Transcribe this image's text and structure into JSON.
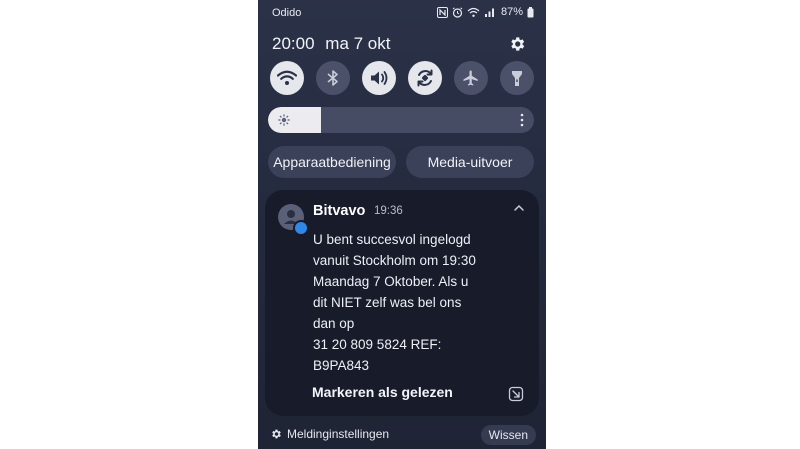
{
  "status_bar": {
    "carrier": "Odido",
    "battery": "87%",
    "icons": [
      "nfc-icon",
      "alarm-icon",
      "wifi-icon",
      "signal-icon",
      "battery-icon"
    ]
  },
  "header": {
    "time": "20:00",
    "date": "ma 7 okt"
  },
  "quick_settings": [
    {
      "icon": "wifi-icon",
      "state": "on"
    },
    {
      "icon": "bluetooth-icon",
      "state": "off"
    },
    {
      "icon": "sound-icon",
      "state": "on"
    },
    {
      "icon": "auto-rotate-icon",
      "state": "on"
    },
    {
      "icon": "airplane-mode-icon",
      "state": "off"
    },
    {
      "icon": "flashlight-icon",
      "state": "off"
    }
  ],
  "brightness": {
    "level": 0.2
  },
  "pills": {
    "device_control": "Apparaatbediening",
    "media_output": "Media-uitvoer"
  },
  "notification": {
    "app": "Bitvavo",
    "time": "19:36",
    "lines": [
      "U bent succesvol ingelogd",
      "vanuit Stockholm om 19:30",
      "Maandag 7 Oktober. Als u",
      "dit NIET zelf was bel ons",
      "dan op",
      "31 20 809 5824 REF:",
      "B9PA843"
    ],
    "action": "Markeren als gelezen"
  },
  "footer": {
    "settings_label": "Meldinginstellingen",
    "clear_label": "Wissen"
  },
  "colors": {
    "panel_bg": "#252b3f",
    "card_bg": "#171b2a",
    "toggle_on": "#e6e7ec",
    "toggle_off": "#4a5168",
    "badge": "#2f88e8"
  }
}
